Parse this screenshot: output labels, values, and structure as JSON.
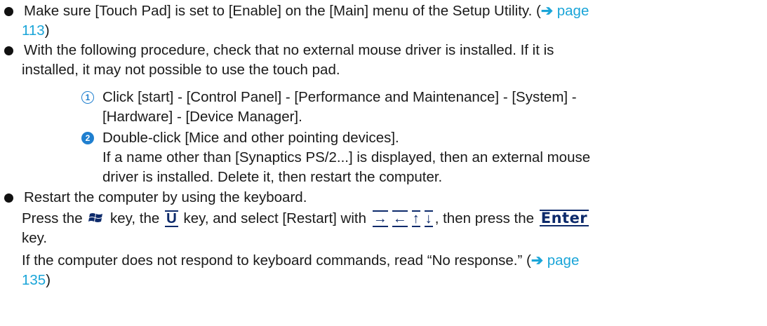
{
  "bullets": [
    {
      "lines": [
        {
          "text": "Make sure [Touch Pad] is set to [Enable] on the [Main] menu of the Setup Utility. (",
          "link_arrow": "➔",
          "link_text": " page"
        },
        {
          "link_text": "113",
          "after": ")"
        }
      ]
    },
    {
      "lines": [
        {
          "text": "With the following procedure, check that no external mouse driver is installed. If it is"
        },
        {
          "text": "installed, it may not possible to use the touch pad."
        }
      ]
    },
    {
      "lines": [
        {
          "text": "Restart the computer by using the keyboard."
        }
      ],
      "keyboard_line": {
        "prefix": "Press the ",
        "after_win": " key, the ",
        "u_key": "U",
        "after_u": " key, and select [Restart] with ",
        "arrows": [
          "→",
          "←",
          "↑",
          "↓"
        ],
        "after_arrows": ",  then press the ",
        "enter_key": "Enter"
      },
      "lines_after": [
        {
          "text": "key."
        },
        {
          "text": "If the computer does not respond to keyboard commands, read “No response.” (",
          "link_arrow": "➔",
          "link_text": " page"
        },
        {
          "link_text": "135",
          "after": ")"
        }
      ]
    }
  ],
  "steps": [
    {
      "num": "1",
      "lines": [
        "Click [start] - [Control Panel] - [Performance and Maintenance] - [System] -",
        "[Hardware] - [Device Manager]."
      ]
    },
    {
      "num": "2",
      "lines": [
        "Double-click [Mice and other pointing devices].",
        "If a name other than [Synaptics PS/2...] is displayed, then an external mouse",
        "driver is installed. Delete it, then restart the computer."
      ]
    }
  ],
  "colors": {
    "link": "#1aa5d8",
    "step_badge": "#1f7fcf",
    "key_text": "#0d2a6b"
  },
  "icons": {
    "windows_key": "windows-key-icon",
    "link_arrow": "right-arrow-icon"
  }
}
